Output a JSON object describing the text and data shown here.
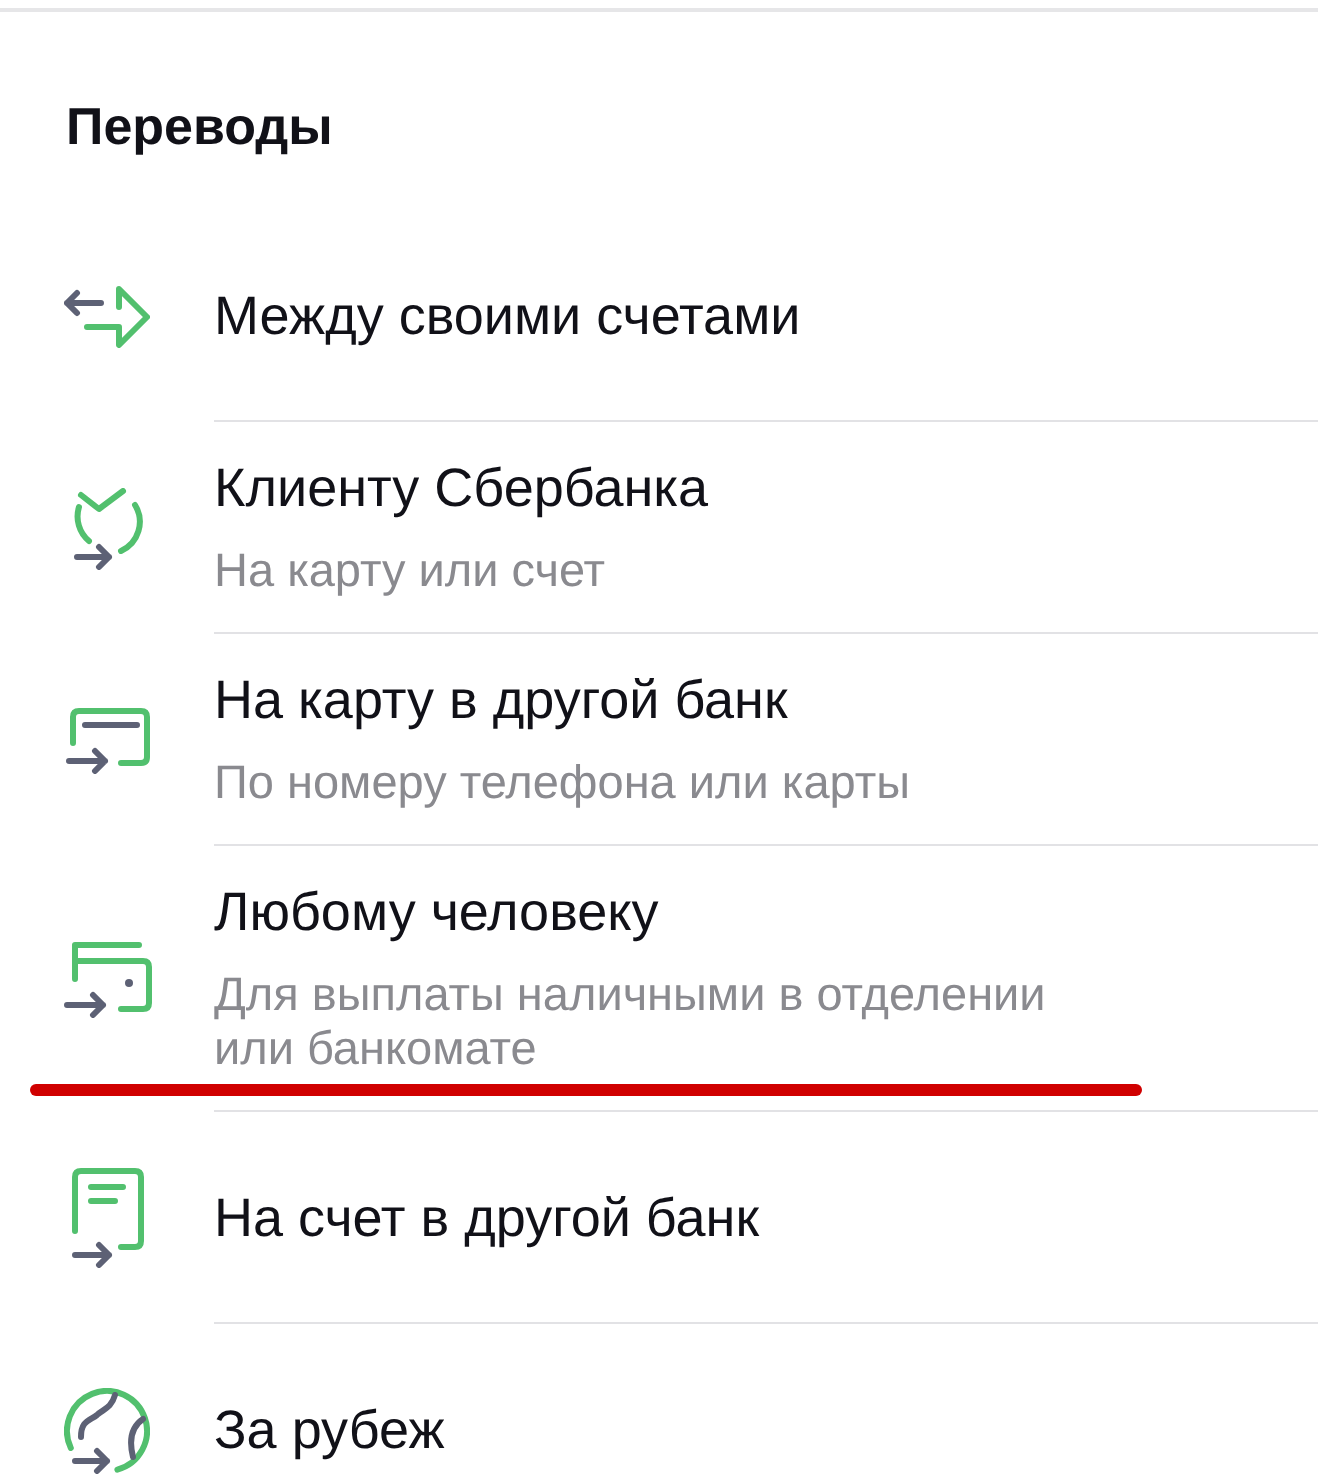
{
  "section": {
    "title": "Переводы"
  },
  "items": [
    {
      "kind": "exchange",
      "title": "Между своими счетами",
      "underlined": false
    },
    {
      "kind": "client",
      "title": "Клиенту Сбербанка",
      "subtitle": "На карту или счет",
      "underlined": false
    },
    {
      "kind": "card",
      "title": "На карту в другой банк",
      "subtitle": "По номеру телефона или карты",
      "underlined": false
    },
    {
      "kind": "wallet",
      "title": "Любому человеку",
      "subtitle": "Для выплаты наличными в отделении или банкомате",
      "underlined": true
    },
    {
      "kind": "document",
      "title": "На счет в другой банк",
      "underlined": false
    },
    {
      "kind": "globe",
      "title": "За рубеж",
      "underlined": false
    }
  ]
}
